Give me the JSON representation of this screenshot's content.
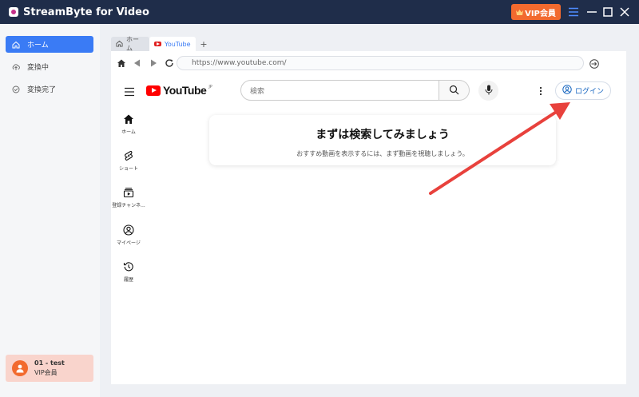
{
  "app": {
    "title": "StreamByte for Video",
    "vip_button": "VIP会員"
  },
  "sidebar": {
    "items": [
      {
        "label": "ホーム",
        "icon": "home-icon",
        "active": true
      },
      {
        "label": "変換中",
        "icon": "cloud-upload-icon",
        "active": false
      },
      {
        "label": "変換完了",
        "icon": "check-circle-icon",
        "active": false
      }
    ],
    "user": {
      "name": "01 - test",
      "level": "VIP会員"
    }
  },
  "browser": {
    "tabs": [
      {
        "label": "ホーム",
        "icon": "home-icon"
      },
      {
        "label": "YouTube",
        "icon": "youtube-icon"
      }
    ],
    "new_tab": "+",
    "url": "https://www.youtube.com/"
  },
  "youtube": {
    "logo_text": "YouTube",
    "region": "JP",
    "search_placeholder": "検索",
    "login_label": "ログイン",
    "guide": [
      {
        "label": "ホーム",
        "icon": "home-icon"
      },
      {
        "label": "ショート",
        "icon": "shorts-icon"
      },
      {
        "label": "登録チャンネ...",
        "icon": "subscriptions-icon"
      },
      {
        "label": "マイページ",
        "icon": "account-icon"
      },
      {
        "label": "履歴",
        "icon": "history-icon"
      }
    ],
    "prompt_title": "まずは検索してみましょう",
    "prompt_subtitle": "おすすめ動画を表示するには、まず動画を視聴しましょう。"
  },
  "colors": {
    "titlebar": "#1f2d4a",
    "accent": "#3a7bf5",
    "vip": "#f26a2e",
    "annotation_arrow": "#e8413c"
  }
}
